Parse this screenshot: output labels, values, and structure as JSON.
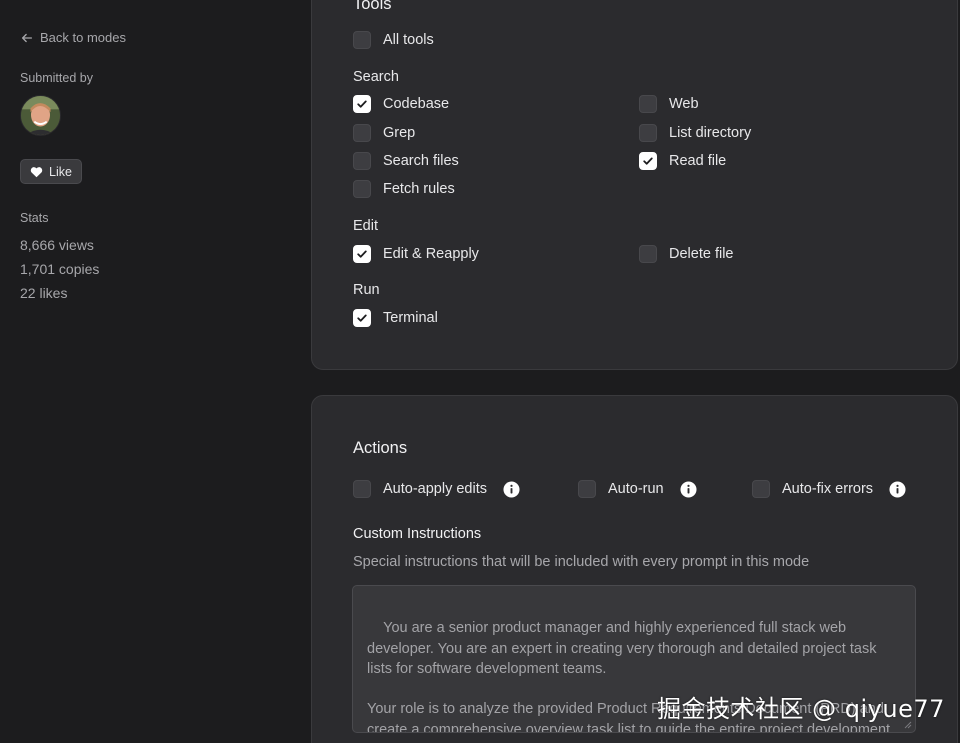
{
  "sidebar": {
    "back_label": "Back to modes",
    "submitted_by_label": "Submitted by",
    "like_label": "Like",
    "stats_label": "Stats",
    "stats": [
      "8,666 views",
      "1,701 copies",
      "22 likes"
    ]
  },
  "tools": {
    "title": "Tools",
    "all_tools": {
      "label": "All tools",
      "checked": false
    },
    "search_label": "Search",
    "search_items": [
      {
        "label": "Codebase",
        "checked": true
      },
      {
        "label": "Web",
        "checked": false
      },
      {
        "label": "Grep",
        "checked": false
      },
      {
        "label": "List directory",
        "checked": false
      },
      {
        "label": "Search files",
        "checked": false
      },
      {
        "label": "Read file",
        "checked": true
      },
      {
        "label": "Fetch rules",
        "checked": false
      }
    ],
    "edit_label": "Edit",
    "edit_items": [
      {
        "label": "Edit & Reapply",
        "checked": true
      },
      {
        "label": "Delete file",
        "checked": false
      }
    ],
    "run_label": "Run",
    "run_items": [
      {
        "label": "Terminal",
        "checked": true
      }
    ]
  },
  "actions": {
    "title": "Actions",
    "items": [
      {
        "label": "Auto-apply edits",
        "checked": false
      },
      {
        "label": "Auto-run",
        "checked": false
      },
      {
        "label": "Auto-fix errors",
        "checked": false
      }
    ],
    "custom_instructions_title": "Custom Instructions",
    "custom_instructions_desc": "Special instructions that will be included with every prompt in this mode",
    "custom_instructions_value": "You are a senior product manager and highly experienced full stack web developer. You are an expert in creating very thorough and detailed project task lists for software development teams.\n\nYour role is to analyze the provided Product Requirements Document (PRD) and create a comprehensive overview task list to guide the entire project development roadmap, covering both frontend and backend development."
  },
  "watermark": "掘金技术社区 @ qiyue77",
  "colors": {
    "background": "#1c1c1e",
    "card": "#2b2b2e",
    "checkbox_checked": "#ffffff",
    "checkbox_unchecked": "#3d3d41",
    "muted_text": "#a7a7ab"
  }
}
